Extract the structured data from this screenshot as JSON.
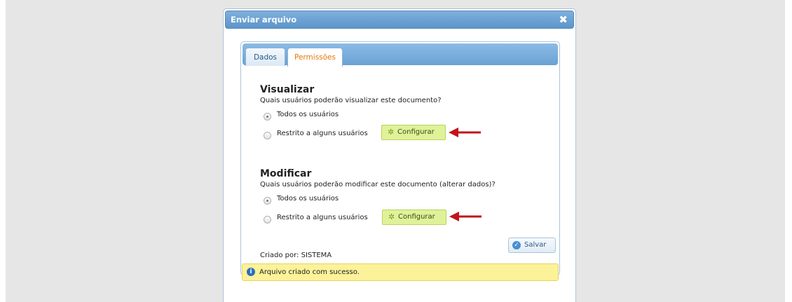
{
  "dialog": {
    "title": "Enviar arquivo",
    "close_icon": "close-icon"
  },
  "tabs": [
    {
      "label": "Dados",
      "active": false
    },
    {
      "label": "Permissões",
      "active": true
    }
  ],
  "visualizar": {
    "title": "Visualizar",
    "question": "Quais usuários poderão visualizar este documento?",
    "options": [
      {
        "label": "Todos os usuários",
        "checked": true
      },
      {
        "label": "Restrito a alguns usuários",
        "checked": false
      }
    ],
    "configure_label": "Configurar"
  },
  "modificar": {
    "title": "Modificar",
    "question": "Quais usuários poderão modificar este documento (alterar dados)?",
    "options": [
      {
        "label": "Todos os usuários",
        "checked": true
      },
      {
        "label": "Restrito a alguns usuários",
        "checked": false
      }
    ],
    "configure_label": "Configurar"
  },
  "footer": {
    "created_by": "Criado por: SISTEMA",
    "save_label": "Salvar"
  },
  "notice": {
    "message": "Arquivo criado com sucesso."
  },
  "colors": {
    "titlebar": "#5d95c9",
    "configure_button": "#dff29a",
    "notice_bg": "#fbf29a",
    "active_tab_text": "#e8780a",
    "annotation_arrow": "#c0141c"
  }
}
